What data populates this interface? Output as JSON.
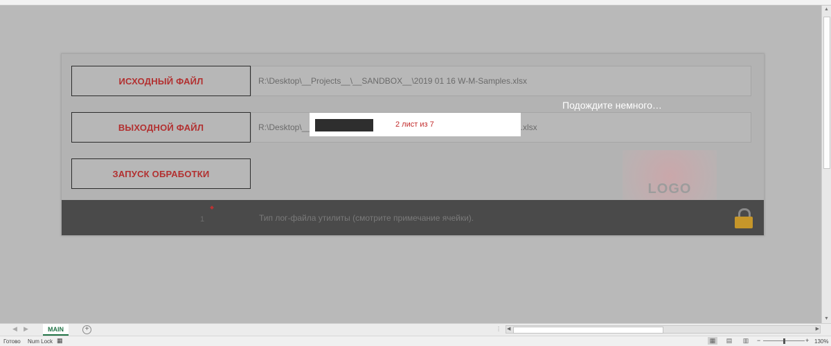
{
  "panel": {
    "source_button": "ИСХОДНЫЙ ФАЙЛ",
    "source_path": "R:\\Desktop\\__Projects__\\__SANDBOX__\\2019 01 16 W-M-Samples.xlsx",
    "output_button": "ВЫХОДНОЙ ФАЙЛ",
    "output_path_start": "R:\\Desktop\\__F",
    "output_path_end": "i.xlsx",
    "run_button": "ЗАПУСК ОБРАБОТКИ",
    "footer_number": "1",
    "footer_text": "Тип лог-файла утилиты (смотрите примечание ячейки).",
    "logo_text": "LOGO"
  },
  "overlay": {
    "wait_text": "Подождите немного…",
    "progress_label": "2 лист из 7",
    "progress_fraction": 0.29
  },
  "tabbar": {
    "sheet_tab": "MAIN",
    "add_sheet": "+",
    "dots": "⋮"
  },
  "statusbar": {
    "ready": "Готово",
    "numlock": "Num Lock",
    "zoom_minus": "−",
    "zoom_plus": "+",
    "zoom": "130%"
  },
  "colors": {
    "accent_red": "#b23030",
    "excel_green": "#217346",
    "lock_gold": "#c6962a"
  }
}
